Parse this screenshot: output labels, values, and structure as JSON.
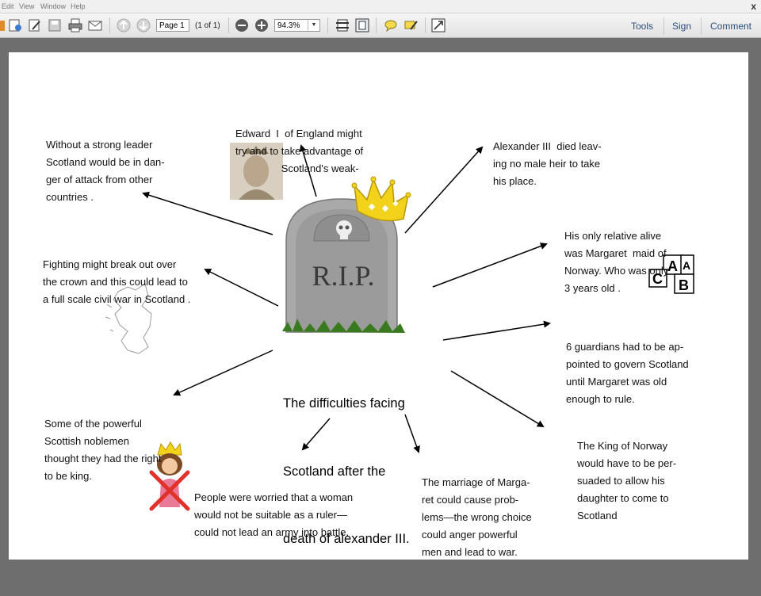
{
  "menubar": {
    "items": [
      "Edit",
      "View",
      "Window",
      "Help"
    ],
    "close": "x"
  },
  "toolbar": {
    "page_value": "Page 1",
    "page_count": "(1 of 1)",
    "zoom_value": "94.3%",
    "tools": "Tools",
    "sign": "Sign",
    "comment": "Comment"
  },
  "doc": {
    "title_lines": [
      "The difficulties facing",
      "Scotland after the",
      "death of alexander III."
    ],
    "tombstone_text": "R.I.P.",
    "blocks": {
      "strong_leader": [
        "Without a strong leader",
        "Scotland would be in dan-",
        "ger of attack from other",
        "countries ."
      ],
      "edward": [
        "Edward  I  of England might",
        "try and to take advantage of",
        "                Scotland's weak-"
      ],
      "alexander": [
        "Alexander III  died leav-",
        "ing no male heir to take",
        "his place."
      ],
      "relative": [
        "His only relative alive",
        "was Margaret  maid of",
        "Norway. Who was only",
        "3 years old ."
      ],
      "fighting": [
        "Fighting might break out over",
        "the crown and this could lead to",
        "a full scale civil war in Scotland ."
      ],
      "guardians": [
        "6 guardians had to be ap-",
        "pointed to govern Scotland",
        "until Margaret was old",
        "enough to rule."
      ],
      "noblemen": [
        "Some of the powerful",
        "Scottish noblemen",
        "thought they had the right",
        "to be king."
      ],
      "norway": [
        "The King of Norway",
        "would have to be per-",
        "suaded to allow his",
        "daughter to come to",
        "Scotland"
      ],
      "woman": [
        "People were worried that a woman",
        "would not be suitable as a ruler—",
        "could not lead an army into battle."
      ],
      "marriage": [
        "The marriage of Marga-",
        "ret could cause prob-",
        "lems—the wrong choice",
        "could anger powerful",
        "men and lead to war."
      ]
    },
    "blocks_text": [
      "A",
      "A",
      "C",
      "B"
    ]
  },
  "colors": {
    "link": "#2a4e78",
    "crown": "#f2d21a",
    "stone": "#a9a9a9",
    "grass": "#3a7a1e",
    "cross": "#e0322a"
  }
}
